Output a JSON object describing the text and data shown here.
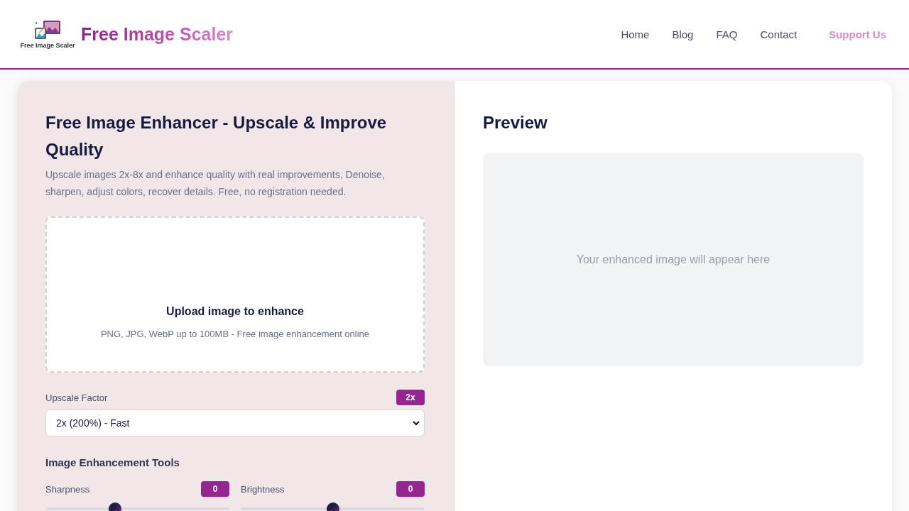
{
  "header": {
    "logo_caption": "Free Image Scaler",
    "title": "Free Image Scaler",
    "nav": [
      {
        "label": "Home",
        "kind": "link"
      },
      {
        "label": "Blog",
        "kind": "link"
      },
      {
        "label": "FAQ",
        "kind": "link"
      },
      {
        "label": "Contact",
        "kind": "link"
      },
      {
        "label": "Support Us",
        "kind": "accent"
      }
    ]
  },
  "editor": {
    "title": "Free Image Enhancer - Upscale & Improve Quality",
    "description": "Upscale images 2x-8x and enhance quality with real improvements. Denoise, sharpen, adjust colors, recover details. Free, no registration needed.",
    "upload": {
      "title": "Upload image to enhance",
      "hint": "PNG, JPG, WebP up to 100MB - Free image enhancement online"
    },
    "upscale": {
      "label": "Upscale Factor",
      "badge": "2x",
      "value": "2x (200%) - Fast"
    },
    "tools": {
      "title": "Image Enhancement Tools",
      "sliders": [
        {
          "label": "Sharpness",
          "value": "0",
          "level": 0.38
        },
        {
          "label": "Brightness",
          "value": "0",
          "level": 0.5
        }
      ]
    }
  },
  "preview": {
    "title": "Preview",
    "empty_message": "Your enhanced image will appear here"
  }
}
